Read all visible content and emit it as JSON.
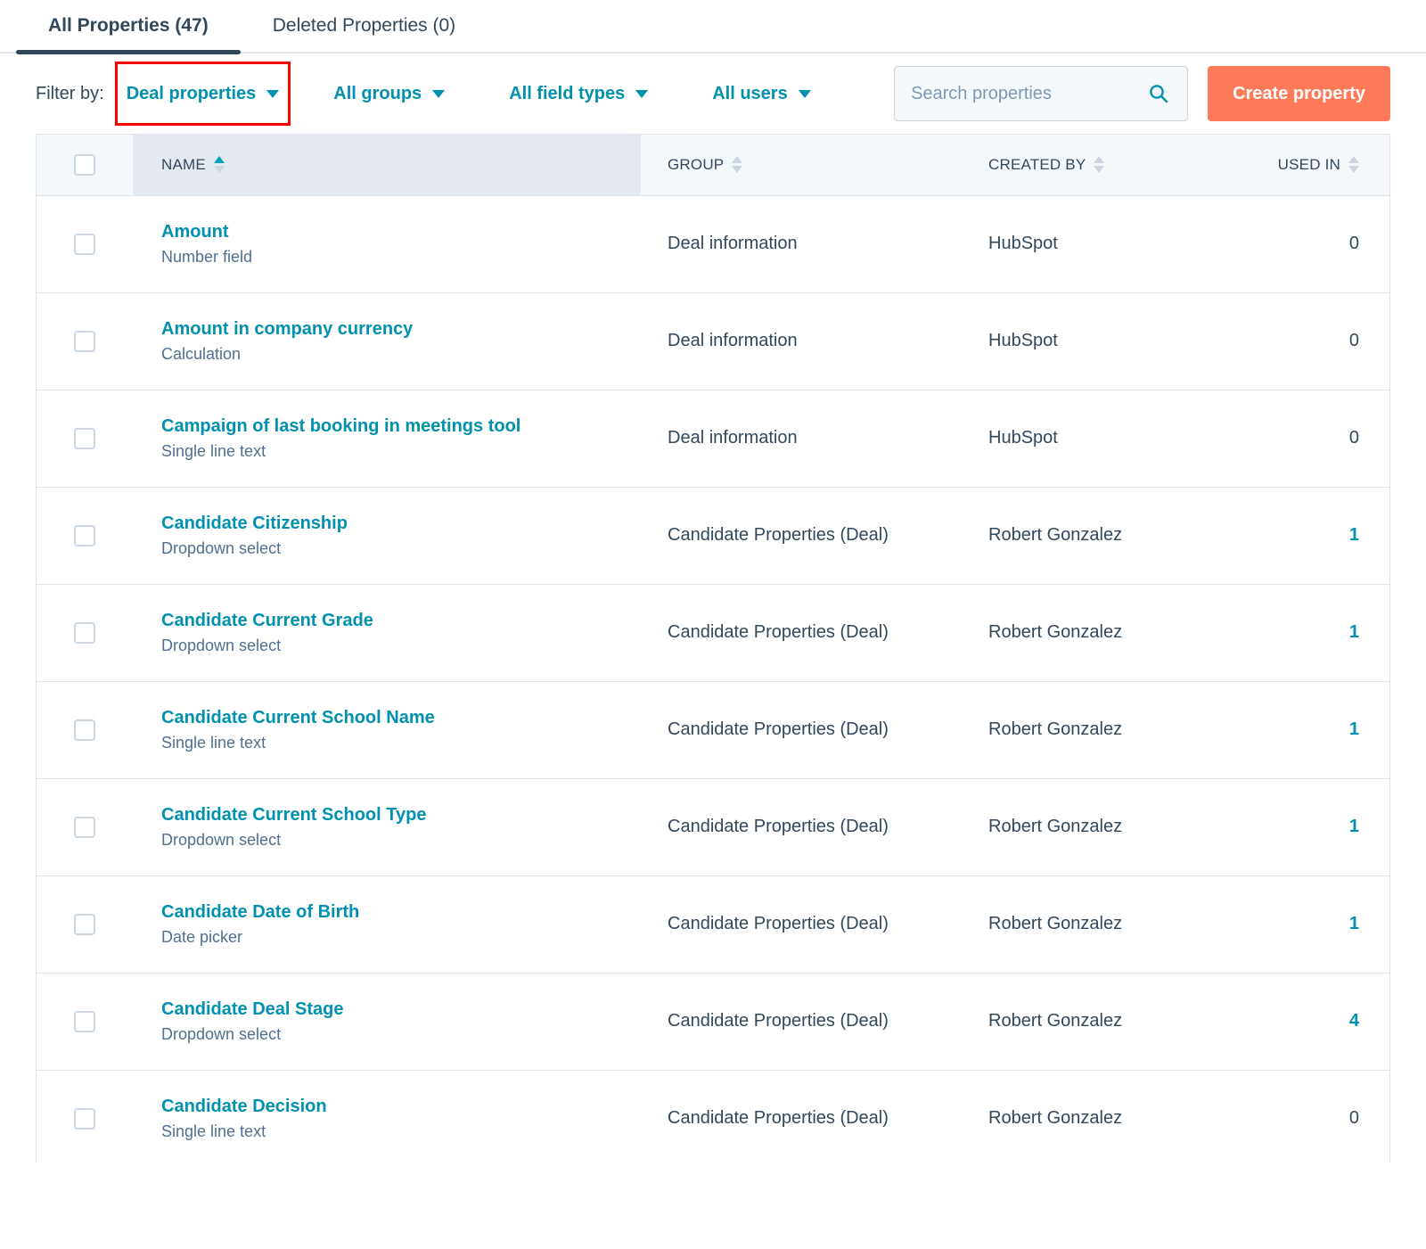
{
  "tabs": [
    {
      "label": "All Properties (47)",
      "active": true
    },
    {
      "label": "Deleted Properties (0)",
      "active": false
    }
  ],
  "filters": {
    "label": "Filter by:",
    "items": [
      {
        "label": "Deal properties",
        "highlighted": true
      },
      {
        "label": "All groups",
        "highlighted": false
      },
      {
        "label": "All field types",
        "highlighted": false
      },
      {
        "label": "All users",
        "highlighted": false
      }
    ]
  },
  "search": {
    "placeholder": "Search properties",
    "value": "",
    "icon": "search-icon"
  },
  "create_button": {
    "label": "Create property"
  },
  "colors": {
    "accent_teal": "#0091ae",
    "sort_active": "#00a4bd",
    "brand_orange": "#ff7a59",
    "text_navy": "#33475b",
    "highlight_red": "#ff0000"
  },
  "table": {
    "columns": [
      {
        "key": "checkbox",
        "label": "",
        "sortable": false
      },
      {
        "key": "name",
        "label": "NAME",
        "sortable": true,
        "sort": "asc"
      },
      {
        "key": "group",
        "label": "GROUP",
        "sortable": true,
        "sort": "none"
      },
      {
        "key": "created_by",
        "label": "CREATED BY",
        "sortable": true,
        "sort": "none"
      },
      {
        "key": "used_in",
        "label": "USED IN",
        "sortable": true,
        "sort": "none"
      }
    ],
    "rows": [
      {
        "name": "Amount",
        "type": "Number field",
        "group": "Deal information",
        "created_by": "HubSpot",
        "used_in": "0",
        "used_in_link": false
      },
      {
        "name": "Amount in company currency",
        "type": "Calculation",
        "group": "Deal information",
        "created_by": "HubSpot",
        "used_in": "0",
        "used_in_link": false
      },
      {
        "name": "Campaign of last booking in meetings tool",
        "type": "Single line text",
        "group": "Deal information",
        "created_by": "HubSpot",
        "used_in": "0",
        "used_in_link": false
      },
      {
        "name": "Candidate Citizenship",
        "type": "Dropdown select",
        "group": "Candidate Properties (Deal)",
        "created_by": "Robert Gonzalez",
        "used_in": "1",
        "used_in_link": true
      },
      {
        "name": "Candidate Current Grade",
        "type": "Dropdown select",
        "group": "Candidate Properties (Deal)",
        "created_by": "Robert Gonzalez",
        "used_in": "1",
        "used_in_link": true
      },
      {
        "name": "Candidate Current School Name",
        "type": "Single line text",
        "group": "Candidate Properties (Deal)",
        "created_by": "Robert Gonzalez",
        "used_in": "1",
        "used_in_link": true
      },
      {
        "name": "Candidate Current School Type",
        "type": "Dropdown select",
        "group": "Candidate Properties (Deal)",
        "created_by": "Robert Gonzalez",
        "used_in": "1",
        "used_in_link": true
      },
      {
        "name": "Candidate Date of Birth",
        "type": "Date picker",
        "group": "Candidate Properties (Deal)",
        "created_by": "Robert Gonzalez",
        "used_in": "1",
        "used_in_link": true
      },
      {
        "name": "Candidate Deal Stage",
        "type": "Dropdown select",
        "group": "Candidate Properties (Deal)",
        "created_by": "Robert Gonzalez",
        "used_in": "4",
        "used_in_link": true
      },
      {
        "name": "Candidate Decision",
        "type": "Single line text",
        "group": "Candidate Properties (Deal)",
        "created_by": "Robert Gonzalez",
        "used_in": "0",
        "used_in_link": false
      }
    ]
  }
}
